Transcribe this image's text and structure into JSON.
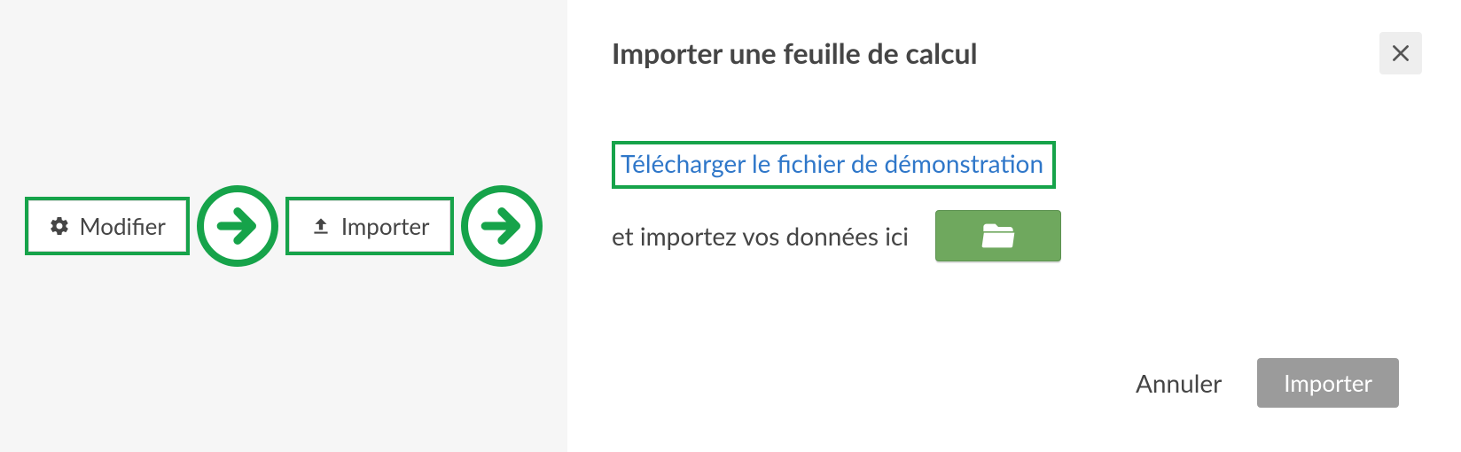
{
  "left": {
    "modify_label": "Modifier",
    "import_label": "Importer"
  },
  "dialog": {
    "title": "Importer une feuille de calcul",
    "demo_link": "Télécharger le fichier de démonstration",
    "import_text": "et importez vos données ici",
    "cancel": "Annuler",
    "submit": "Importer"
  }
}
